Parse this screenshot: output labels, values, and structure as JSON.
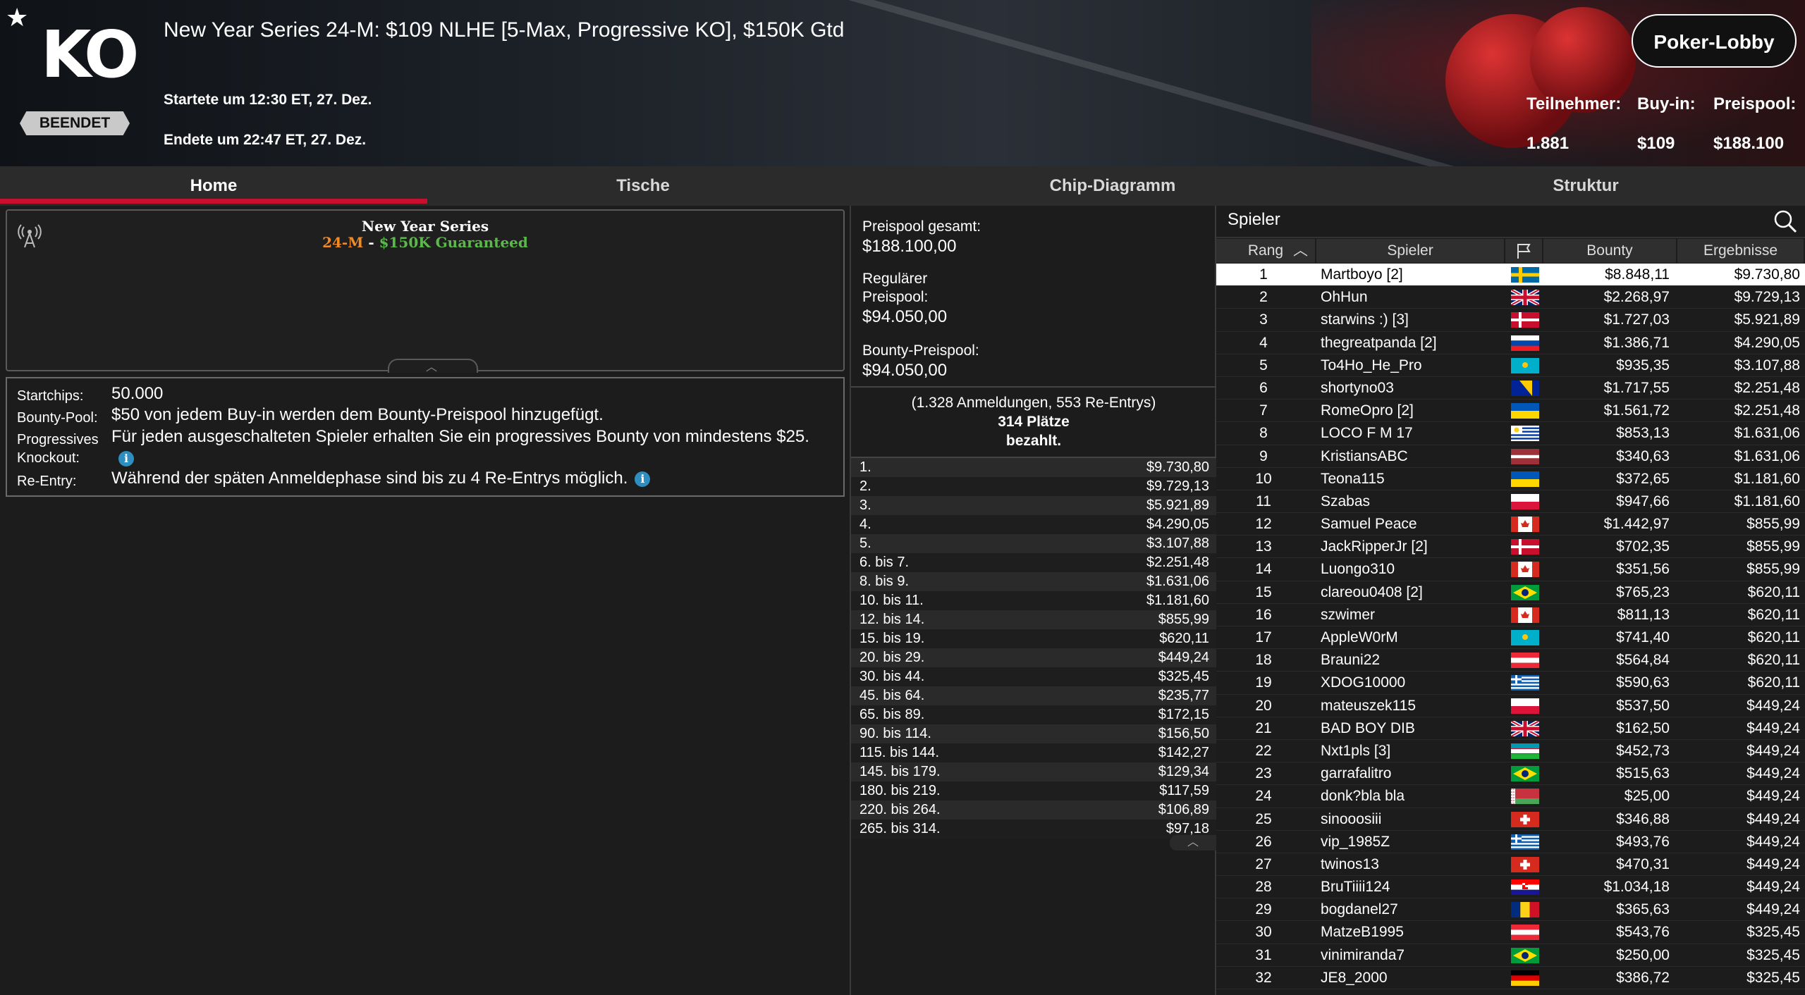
{
  "header": {
    "logo_text": "KO",
    "status_badge": "BEENDET",
    "title": "New Year Series 24-M: $109 NLHE [5-Max, Progressive KO], $150K Gtd",
    "started": "Startete um 12:30 ET, 27. Dez.",
    "ended": "Endete um 22:47 ET, 27. Dez.",
    "lobby_button": "Poker-Lobby",
    "stats": [
      {
        "label": "Teilnehmer:",
        "value": "1.881"
      },
      {
        "label": "Buy-in:",
        "value": "$109"
      },
      {
        "label": "Preispool:",
        "value": "$188.100"
      }
    ]
  },
  "tabs": [
    "Home",
    "Tische",
    "Chip-Diagramm",
    "Struktur"
  ],
  "active_tab": "Home",
  "series_banner": {
    "title": "New Year Series",
    "code": "24-M",
    "dash": " - ",
    "guarantee": "$150K Guaranteed"
  },
  "details": [
    {
      "label": "Startchips:",
      "value": "50.000"
    },
    {
      "label": "Bounty-Pool:",
      "value": "$50 von jedem Buy-in werden dem Bounty-Preispool hinzugefügt."
    },
    {
      "label": "Progressives Knockout:",
      "value": "Für jeden ausgeschalteten Spieler erhalten Sie ein progressives Bounty von mindestens $25."
    },
    {
      "label": "Re-Entry:",
      "value": "Während der späten Anmeldephase sind bis zu 4 Re-Entrys möglich."
    }
  ],
  "prize_pool": {
    "total_label": "Preispool gesamt:",
    "total_value": "$188.100,00",
    "regular_label_1": "Regulärer",
    "regular_label_2": "Preispool:",
    "regular_value": "$94.050,00",
    "bounty_label": "Bounty-Preispool:",
    "bounty_value": "$94.050,00",
    "entries_line": "(1.328 Anmeldungen, 553 Re-Entrys)",
    "places_line": "314 Plätze",
    "paid_line": "bezahlt."
  },
  "payouts": [
    {
      "place": "1.",
      "amount": "$9.730,80"
    },
    {
      "place": "2.",
      "amount": "$9.729,13"
    },
    {
      "place": "3.",
      "amount": "$5.921,89"
    },
    {
      "place": "4.",
      "amount": "$4.290,05"
    },
    {
      "place": "5.",
      "amount": "$3.107,88"
    },
    {
      "place": "6. bis 7.",
      "amount": "$2.251,48"
    },
    {
      "place": "8. bis 9.",
      "amount": "$1.631,06"
    },
    {
      "place": "10. bis 11.",
      "amount": "$1.181,60"
    },
    {
      "place": "12. bis 14.",
      "amount": "$855,99"
    },
    {
      "place": "15. bis 19.",
      "amount": "$620,11"
    },
    {
      "place": "20. bis 29.",
      "amount": "$449,24"
    },
    {
      "place": "30. bis 44.",
      "amount": "$325,45"
    },
    {
      "place": "45. bis 64.",
      "amount": "$235,77"
    },
    {
      "place": "65. bis 89.",
      "amount": "$172,15"
    },
    {
      "place": "90. bis 114.",
      "amount": "$156,50"
    },
    {
      "place": "115. bis 144.",
      "amount": "$142,27"
    },
    {
      "place": "145. bis 179.",
      "amount": "$129,34"
    },
    {
      "place": "180. bis 219.",
      "amount": "$117,59"
    },
    {
      "place": "220. bis 264.",
      "amount": "$106,89"
    },
    {
      "place": "265. bis 314.",
      "amount": "$97,18"
    }
  ],
  "players_panel": {
    "title": "Spieler",
    "columns": [
      "Rang",
      "Spieler",
      "",
      "Bounty",
      "Ergebnisse"
    ],
    "rows": [
      {
        "rank": "1",
        "name": "Martboyo [2]",
        "flag": "sweden",
        "bounty": "$8.848,11",
        "result": "$9.730,80"
      },
      {
        "rank": "2",
        "name": "OhHun",
        "flag": "uk",
        "bounty": "$2.268,97",
        "result": "$9.729,13"
      },
      {
        "rank": "3",
        "name": "starwins :) [3]",
        "flag": "denmark",
        "bounty": "$1.727,03",
        "result": "$5.921,89"
      },
      {
        "rank": "4",
        "name": "thegreatpanda [2]",
        "flag": "slovenia",
        "bounty": "$1.386,71",
        "result": "$4.290,05"
      },
      {
        "rank": "5",
        "name": "To4Ho_He_Pro",
        "flag": "kazakhstan",
        "bounty": "$935,35",
        "result": "$3.107,88"
      },
      {
        "rank": "6",
        "name": "shortyno03",
        "flag": "bosnia",
        "bounty": "$1.717,55",
        "result": "$2.251,48"
      },
      {
        "rank": "7",
        "name": "RomeOpro [2]",
        "flag": "ukraine",
        "bounty": "$1.561,72",
        "result": "$2.251,48"
      },
      {
        "rank": "8",
        "name": "LOCO F M 17",
        "flag": "uruguay",
        "bounty": "$853,13",
        "result": "$1.631,06"
      },
      {
        "rank": "9",
        "name": "KristiansABC",
        "flag": "latvia",
        "bounty": "$340,63",
        "result": "$1.631,06"
      },
      {
        "rank": "10",
        "name": "Teona115",
        "flag": "ukraine",
        "bounty": "$372,65",
        "result": "$1.181,60"
      },
      {
        "rank": "11",
        "name": "Szabas",
        "flag": "poland",
        "bounty": "$947,66",
        "result": "$1.181,60"
      },
      {
        "rank": "12",
        "name": "Samuel Peace",
        "flag": "canada",
        "bounty": "$1.442,97",
        "result": "$855,99"
      },
      {
        "rank": "13",
        "name": "JackRipperJr [2]",
        "flag": "denmark",
        "bounty": "$702,35",
        "result": "$855,99"
      },
      {
        "rank": "14",
        "name": "Luongo310",
        "flag": "canada",
        "bounty": "$351,56",
        "result": "$855,99"
      },
      {
        "rank": "15",
        "name": "clareou0408 [2]",
        "flag": "brazil",
        "bounty": "$765,23",
        "result": "$620,11"
      },
      {
        "rank": "16",
        "name": "szwimer",
        "flag": "canada",
        "bounty": "$811,13",
        "result": "$620,11"
      },
      {
        "rank": "17",
        "name": "AppleW0rM",
        "flag": "kazakhstan",
        "bounty": "$741,40",
        "result": "$620,11"
      },
      {
        "rank": "18",
        "name": "Brauni22",
        "flag": "austria",
        "bounty": "$564,84",
        "result": "$620,11"
      },
      {
        "rank": "19",
        "name": "XDOG10000",
        "flag": "greece",
        "bounty": "$590,63",
        "result": "$620,11"
      },
      {
        "rank": "20",
        "name": "mateuszek115",
        "flag": "poland",
        "bounty": "$537,50",
        "result": "$449,24"
      },
      {
        "rank": "21",
        "name": "BAD BOY DIB",
        "flag": "uk",
        "bounty": "$162,50",
        "result": "$449,24"
      },
      {
        "rank": "22",
        "name": "Nxt1pls [3]",
        "flag": "uzbekistan",
        "bounty": "$452,73",
        "result": "$449,24"
      },
      {
        "rank": "23",
        "name": "garrafalitro",
        "flag": "brazil",
        "bounty": "$515,63",
        "result": "$449,24"
      },
      {
        "rank": "24",
        "name": "donk?bla bla",
        "flag": "belarus",
        "bounty": "$25,00",
        "result": "$449,24"
      },
      {
        "rank": "25",
        "name": "sinooosiii",
        "flag": "switzerland",
        "bounty": "$346,88",
        "result": "$449,24"
      },
      {
        "rank": "26",
        "name": "vip_1985Z",
        "flag": "greece",
        "bounty": "$493,76",
        "result": "$449,24"
      },
      {
        "rank": "27",
        "name": "twinos13",
        "flag": "switzerland",
        "bounty": "$470,31",
        "result": "$449,24"
      },
      {
        "rank": "28",
        "name": "BruTiiii124",
        "flag": "croatia",
        "bounty": "$1.034,18",
        "result": "$449,24"
      },
      {
        "rank": "29",
        "name": "bogdanel27",
        "flag": "romania",
        "bounty": "$365,63",
        "result": "$449,24"
      },
      {
        "rank": "30",
        "name": "MatzeB1995",
        "flag": "austria",
        "bounty": "$543,76",
        "result": "$325,45"
      },
      {
        "rank": "31",
        "name": "vinimiranda7",
        "flag": "brazil",
        "bounty": "$250,00",
        "result": "$325,45"
      },
      {
        "rank": "32",
        "name": "JE8_2000",
        "flag": "germany",
        "bounty": "$386,72",
        "result": "$325,45"
      }
    ]
  },
  "colors": {
    "accent_red": "#c8102e",
    "series_orange": "#f08a24",
    "series_green": "#5bb84a",
    "info_blue": "#2e8ec0"
  }
}
